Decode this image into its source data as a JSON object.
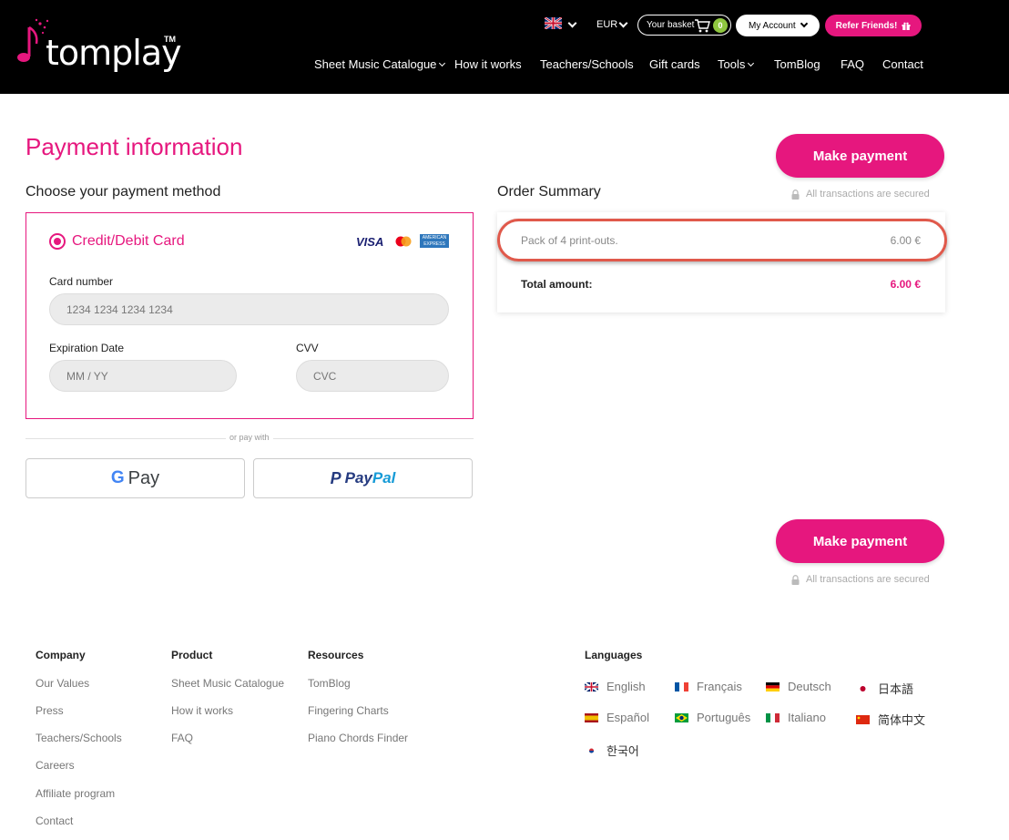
{
  "header": {
    "logo_text": "tomplay",
    "logo_tm": "TM",
    "currency": "EUR",
    "basket_label": "Your basket",
    "basket_count": "0",
    "account_label": "My Account",
    "refer_label": "Refer Friends!",
    "nav": [
      {
        "label": "Sheet Music Catalogue",
        "dropdown": true
      },
      {
        "label": "How it works",
        "dropdown": false
      },
      {
        "label": "Teachers/Schools",
        "dropdown": false
      },
      {
        "label": "Gift cards",
        "dropdown": false
      },
      {
        "label": "Tools",
        "dropdown": true
      },
      {
        "label": "TomBlog",
        "dropdown": false
      },
      {
        "label": "FAQ",
        "dropdown": false
      },
      {
        "label": "Contact",
        "dropdown": false
      }
    ]
  },
  "main": {
    "page_title": "Payment information",
    "make_payment_label": "Make payment",
    "secure_text": "All transactions are secured",
    "choose_method_title": "Choose your payment method",
    "order_summary_title": "Order Summary",
    "card": {
      "method_label": "Credit/Debit Card",
      "visa": "VISA",
      "amex": "AMERICAN EXPRESS",
      "card_number_label": "Card number",
      "card_number_placeholder": "1234 1234 1234 1234",
      "expiration_label": "Expiration Date",
      "expiration_placeholder": "MM / YY",
      "cvv_label": "CVV",
      "cvv_placeholder": "CVC"
    },
    "or_pay_with": "or pay with",
    "gpay_label": "Pay",
    "paypal_label_1": "Pay",
    "paypal_label_2": "Pal",
    "summary": {
      "item": "Pack of 4 print-outs.",
      "item_price": "6.00 €",
      "total_label": "Total amount:",
      "total_value": "6.00 €"
    }
  },
  "footer": {
    "company": {
      "title": "Company",
      "links": [
        "Our Values",
        "Press",
        "Teachers/Schools",
        "Careers",
        "Affiliate program",
        "Contact"
      ]
    },
    "product": {
      "title": "Product",
      "links": [
        "Sheet Music Catalogue",
        "How it works",
        "FAQ"
      ]
    },
    "resources": {
      "title": "Resources",
      "links": [
        "TomBlog",
        "Fingering Charts",
        "Piano Chords Finder"
      ]
    },
    "languages": {
      "title": "Languages",
      "items": [
        "English",
        "Français",
        "Deutsch",
        "日本語",
        "Español",
        "Português",
        "Italiano",
        "简体中文",
        "한국어"
      ]
    }
  },
  "colors": {
    "accent": "#e6177e",
    "header_bg": "#000000",
    "basket_badge": "#8fc63f",
    "highlight_ring": "#e0594b"
  }
}
